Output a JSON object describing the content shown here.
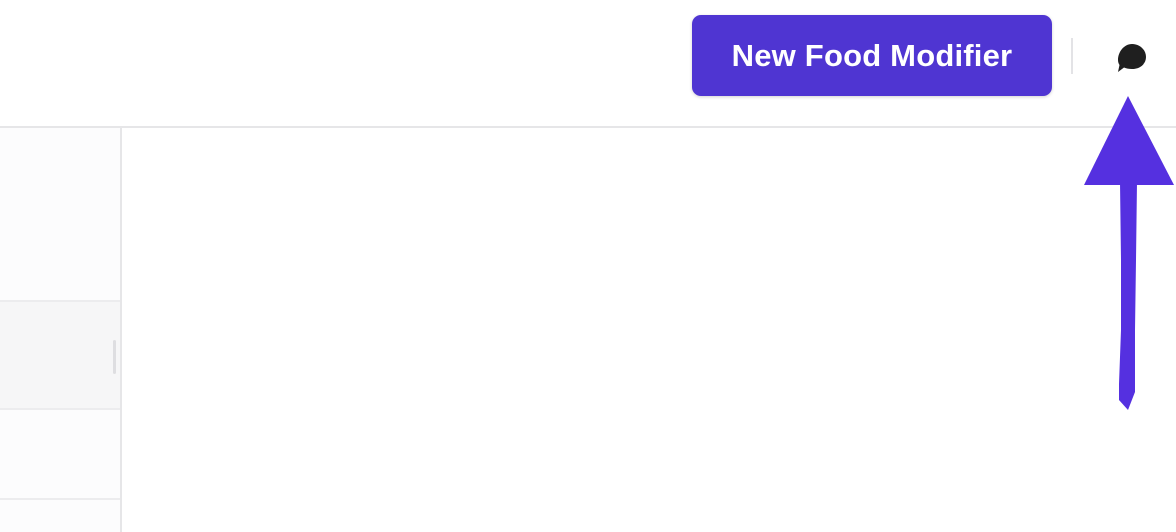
{
  "header": {
    "new_button_label": "New Food Modifier",
    "chat_icon": "chat-bubble-icon"
  },
  "annotation": {
    "arrow_icon": "up-arrow-icon"
  },
  "colors": {
    "accent": "#4f35d2",
    "annotation_arrow": "#5530e0",
    "icon": "#1f1f1f",
    "border": "#e6e6e8"
  }
}
